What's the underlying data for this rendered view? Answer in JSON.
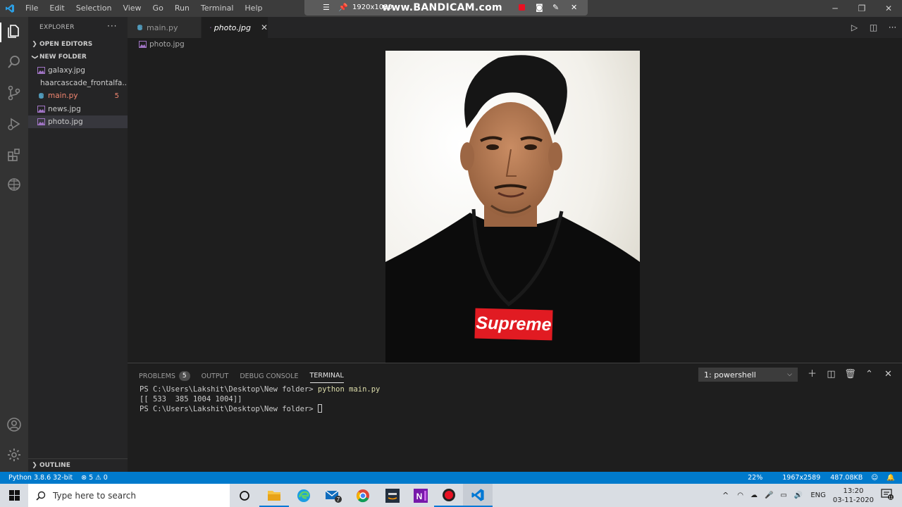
{
  "menu": [
    "File",
    "Edit",
    "Selection",
    "View",
    "Go",
    "Run",
    "Terminal",
    "Help"
  ],
  "bandicam": {
    "resolution": "1920x1080",
    "brand": "www.BANDICAM.com"
  },
  "window_controls": [
    "minimize",
    "maximize",
    "close"
  ],
  "sidebar": {
    "title": "EXPLORER",
    "more": "···",
    "open_editors": "OPEN EDITORS",
    "folder": "NEW FOLDER",
    "files": [
      {
        "name": "galaxy.jpg",
        "icon": "image-file-icon"
      },
      {
        "name": "haarcascade_frontalfa...",
        "icon": "xml-file-icon"
      },
      {
        "name": "main.py",
        "icon": "python-file-icon",
        "problems": "5"
      },
      {
        "name": "news.jpg",
        "icon": "image-file-icon"
      },
      {
        "name": "photo.jpg",
        "icon": "image-file-icon",
        "selected": true
      }
    ],
    "outline": "OUTLINE"
  },
  "tabs": [
    {
      "label": "main.py",
      "active": false
    },
    {
      "label": "photo.jpg",
      "active": true,
      "close": "✕"
    }
  ],
  "breadcrumb": "photo.jpg",
  "image_content": {
    "logo_text": "Supreme"
  },
  "panel": {
    "tabs": [
      "PROBLEMS",
      "OUTPUT",
      "DEBUG CONSOLE",
      "TERMINAL"
    ],
    "problems_count": "5",
    "shell": "1: powershell",
    "terminal": {
      "prompt1": "PS C:\\Users\\Lakshit\\Desktop\\New folder> ",
      "cmd": "python main.py",
      "output": "[[ 533  385 1004 1004]]",
      "prompt2": "PS C:\\Users\\Lakshit\\Desktop\\New folder> "
    }
  },
  "status": {
    "python": "Python 3.8.6 32-bit",
    "errors": "5",
    "warnings": "0",
    "zoom": "22%",
    "dimensions": "1967x2589",
    "size": "487.08KB"
  },
  "taskbar": {
    "search_placeholder": "Type here to search",
    "mail_badge": "7",
    "lang": "ENG",
    "time": "13:20",
    "date": "03-11-2020",
    "notif_count": "11"
  },
  "colors": {
    "accent": "#007acc",
    "editor_bg": "#1e1e1e",
    "sidebar_bg": "#252526",
    "activitybar_bg": "#333333",
    "titlebar_bg": "#3c3c3c",
    "error": "#f48771",
    "supreme_red": "#e11b22"
  }
}
